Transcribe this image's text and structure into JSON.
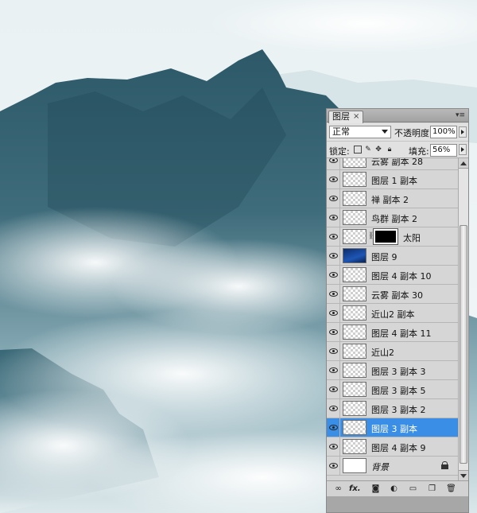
{
  "layers_panel": {
    "tab_title": "图层",
    "tab_close": "×",
    "menu_icon": "panel-menu-icon",
    "blend_mode": "正常",
    "opacity_label": "不透明度:",
    "opacity_value": "100%",
    "lock_label": "锁定:",
    "fill_label": "填充:",
    "fill_value": "56%",
    "layers": [
      {
        "name": "云雾 副本 28",
        "thumb": "checker",
        "visible": true
      },
      {
        "name": "图层 1 副本",
        "thumb": "checker",
        "visible": true
      },
      {
        "name": "禅 副本 2",
        "thumb": "checker",
        "visible": true
      },
      {
        "name": "鸟群 副本 2",
        "thumb": "checker",
        "visible": true
      },
      {
        "name": "太阳",
        "thumb": "checker",
        "mask": "black",
        "visible": true
      },
      {
        "name": "图层 9",
        "thumb": "blue",
        "visible": true
      },
      {
        "name": "图层 4 副本 10",
        "thumb": "checker",
        "visible": true
      },
      {
        "name": "云雾 副本 30",
        "thumb": "checker",
        "visible": true
      },
      {
        "name": "近山2 副本",
        "thumb": "checker",
        "visible": true
      },
      {
        "name": "图层 4 副本 11",
        "thumb": "checker",
        "visible": true
      },
      {
        "name": "近山2",
        "thumb": "checker",
        "visible": true
      },
      {
        "name": "图层 3 副本 3",
        "thumb": "checker",
        "visible": true
      },
      {
        "name": "图层 3 副本 5",
        "thumb": "checker",
        "visible": true
      },
      {
        "name": "图层 3 副本 2",
        "thumb": "checker",
        "visible": true
      },
      {
        "name": "图层 3 副本",
        "thumb": "checker",
        "visible": true,
        "selected": true
      },
      {
        "name": "图层 4 副本 9",
        "thumb": "checker",
        "visible": true
      },
      {
        "name": "背景",
        "thumb": "white",
        "visible": true,
        "locked": true,
        "italic": true
      }
    ],
    "footer_icons": [
      "link-layers-icon",
      "fx-icon",
      "add-mask-icon",
      "adjustment-layer-icon",
      "new-group-icon",
      "new-layer-icon",
      "delete-layer-icon"
    ],
    "footer_fx_label": "fx."
  }
}
